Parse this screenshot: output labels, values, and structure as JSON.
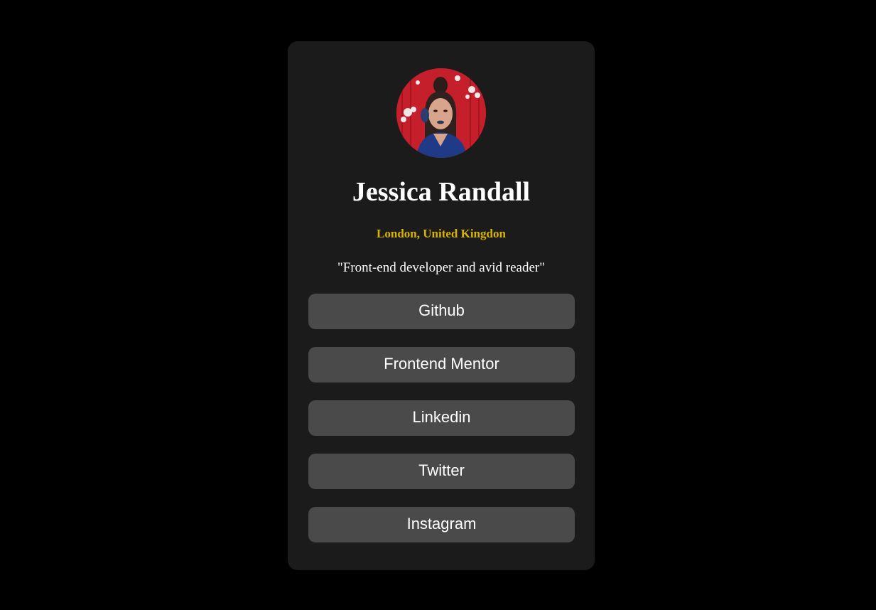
{
  "profile": {
    "name": "Jessica Randall",
    "location": "London, United Kingdon",
    "bio": "\"Front-end developer and avid reader\"",
    "avatar_icon": "profile-photo"
  },
  "links": [
    {
      "label": "Github"
    },
    {
      "label": "Frontend Mentor"
    },
    {
      "label": "Linkedin"
    },
    {
      "label": "Twitter"
    },
    {
      "label": "Instagram"
    }
  ],
  "colors": {
    "page_background": "#000000",
    "card_background": "#1b1b1b",
    "button_background": "#4a4a4a",
    "accent": "#d6b400",
    "text": "#ffffff"
  }
}
